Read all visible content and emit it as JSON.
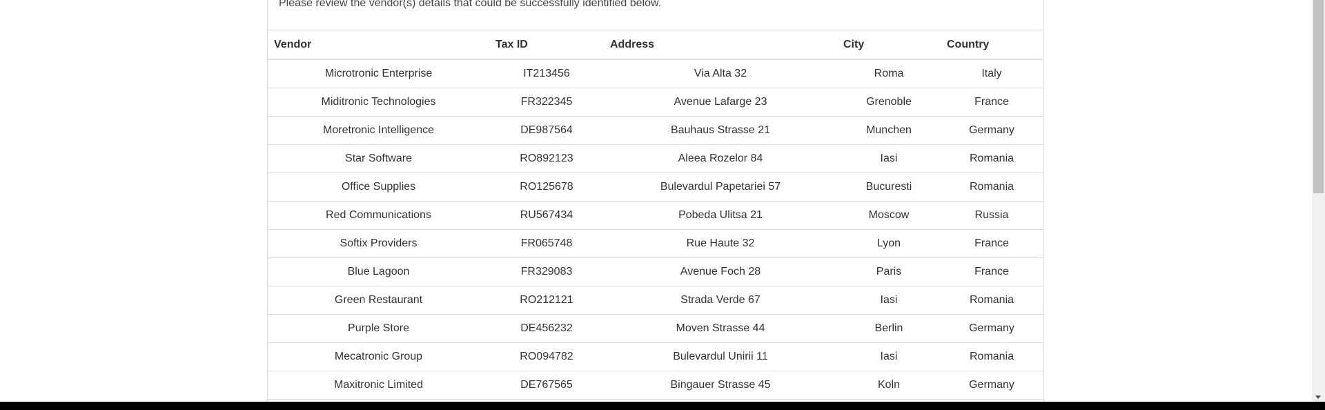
{
  "intro_text": "Please review the vendor(s) details that could be successfully identified below.",
  "table": {
    "headers": {
      "vendor": "Vendor",
      "tax_id": "Tax ID",
      "address": "Address",
      "city": "City",
      "country": "Country"
    },
    "rows": [
      {
        "vendor": "Microtronic Enterprise",
        "tax_id": "IT213456",
        "address": "Via Alta 32",
        "city": "Roma",
        "country": "Italy"
      },
      {
        "vendor": "Miditronic Technologies",
        "tax_id": "FR322345",
        "address": "Avenue Lafarge 23",
        "city": "Grenoble",
        "country": "France"
      },
      {
        "vendor": "Moretronic Intelligence",
        "tax_id": "DE987564",
        "address": "Bauhaus Strasse 21",
        "city": "Munchen",
        "country": "Germany"
      },
      {
        "vendor": "Star Software",
        "tax_id": "RO892123",
        "address": "Aleea Rozelor 84",
        "city": "Iasi",
        "country": "Romania"
      },
      {
        "vendor": "Office Supplies",
        "tax_id": "RO125678",
        "address": "Bulevardul Papetariei 57",
        "city": "Bucuresti",
        "country": "Romania"
      },
      {
        "vendor": "Red Communications",
        "tax_id": "RU567434",
        "address": "Pobeda Ulitsa 21",
        "city": "Moscow",
        "country": "Russia"
      },
      {
        "vendor": "Softix Providers",
        "tax_id": "FR065748",
        "address": "Rue Haute 32",
        "city": "Lyon",
        "country": "France"
      },
      {
        "vendor": "Blue Lagoon",
        "tax_id": "FR329083",
        "address": "Avenue Foch 28",
        "city": "Paris",
        "country": "France"
      },
      {
        "vendor": "Green Restaurant",
        "tax_id": "RO212121",
        "address": "Strada Verde 67",
        "city": "Iasi",
        "country": "Romania"
      },
      {
        "vendor": "Purple Store",
        "tax_id": "DE456232",
        "address": "Moven Strasse 44",
        "city": "Berlin",
        "country": "Germany"
      },
      {
        "vendor": "Mecatronic Group",
        "tax_id": "RO094782",
        "address": "Bulevardul Unirii 11",
        "city": "Iasi",
        "country": "Romania"
      },
      {
        "vendor": "Maxitronic Limited",
        "tax_id": "DE767565",
        "address": "Bingauer Strasse 45",
        "city": "Koln",
        "country": "Germany"
      }
    ]
  }
}
